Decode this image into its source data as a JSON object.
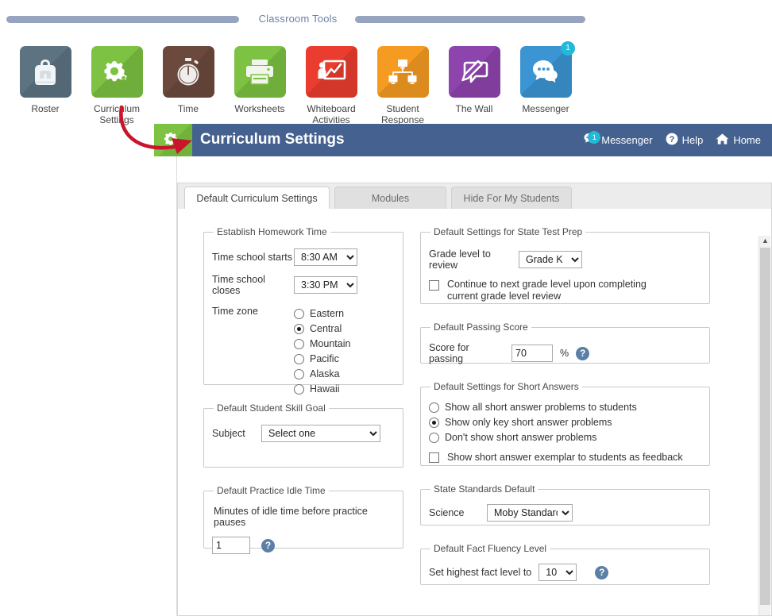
{
  "toolbar": {
    "title": "Classroom Tools",
    "apps": [
      {
        "label": "Roster",
        "icon": "backpack-icon",
        "color": "#5d7382",
        "badge": null
      },
      {
        "label": "Curriculum\nSettings",
        "icon": "gears-icon",
        "color": "#7dc242",
        "badge": null
      },
      {
        "label": "Time",
        "icon": "stopwatch-icon",
        "color": "#6b4a3d",
        "badge": null
      },
      {
        "label": "Worksheets",
        "icon": "printer-icon",
        "color": "#7dc242",
        "badge": null
      },
      {
        "label": "Whiteboard\nActivities",
        "icon": "whiteboard-icon",
        "color": "#ea3d2f",
        "badge": null
      },
      {
        "label": "Student Response\nSystem",
        "icon": "network-icon",
        "color": "#f59b22",
        "badge": null
      },
      {
        "label": "The Wall",
        "icon": "wall-pencil-icon",
        "color": "#8e44ad",
        "badge": null
      },
      {
        "label": "Messenger",
        "icon": "chat-icon",
        "color": "#3b95d3",
        "badge": "1"
      }
    ]
  },
  "header": {
    "title": "Curriculum Settings",
    "icon": "gears-icon",
    "accent_green": "#7dc242",
    "bar_blue": "#44618f",
    "badge_color": "#22b8d8",
    "actions": [
      {
        "label": "Messenger",
        "icon": "chat-icon",
        "badge": "1"
      },
      {
        "label": "Help",
        "icon": "question-circle-icon",
        "badge": null
      },
      {
        "label": "Home",
        "icon": "home-icon",
        "badge": null
      }
    ]
  },
  "tabs": [
    {
      "label": "Default Curriculum Settings",
      "active": true
    },
    {
      "label": "Modules",
      "active": false
    },
    {
      "label": "Hide For My Students",
      "active": false
    }
  ],
  "left_column": {
    "homework_time": {
      "legend": "Establish Homework Time",
      "start_label": "Time school starts",
      "start_value": "8:30 AM",
      "close_label": "Time school closes",
      "close_value": "3:30 PM",
      "timezone_label": "Time zone",
      "timezones": [
        {
          "label": "Eastern",
          "selected": false
        },
        {
          "label": "Central",
          "selected": true
        },
        {
          "label": "Mountain",
          "selected": false
        },
        {
          "label": "Pacific",
          "selected": false
        },
        {
          "label": "Alaska",
          "selected": false
        },
        {
          "label": "Hawaii",
          "selected": false
        }
      ]
    },
    "skill_goal": {
      "legend": "Default Student Skill Goal",
      "subject_label": "Subject",
      "subject_value": "Select one"
    },
    "idle_time": {
      "legend": "Default Practice Idle Time",
      "description": "Minutes of idle time before practice pauses",
      "value": "1",
      "help": "?"
    }
  },
  "right_column": {
    "state_test_prep": {
      "legend": "Default Settings for State Test Prep",
      "grade_label": "Grade level to review",
      "grade_value": "Grade K",
      "continue_label": "Continue to next grade level upon completing current grade level review",
      "continue_checked": false
    },
    "passing_score": {
      "legend": "Default Passing Score",
      "score_label": "Score for passing",
      "score_value": "70",
      "percent": "%",
      "help": "?"
    },
    "short_answers": {
      "legend": "Default Settings for Short Answers",
      "options": [
        {
          "label": "Show all short answer problems to students",
          "selected": false
        },
        {
          "label": "Show only key short answer problems",
          "selected": true
        },
        {
          "label": "Don't show short answer problems",
          "selected": false
        }
      ],
      "exemplar_label": "Show short answer exemplar to students as feedback",
      "exemplar_checked": false
    },
    "state_standards": {
      "legend": "State Standards Default",
      "science_label": "Science",
      "science_value": "Moby Standards"
    },
    "fact_fluency": {
      "legend": "Default Fact Fluency Level",
      "level_label": "Set highest fact level to",
      "level_value": "10",
      "help": "?"
    }
  },
  "annotation": {
    "arrow_color": "#c9152b"
  }
}
